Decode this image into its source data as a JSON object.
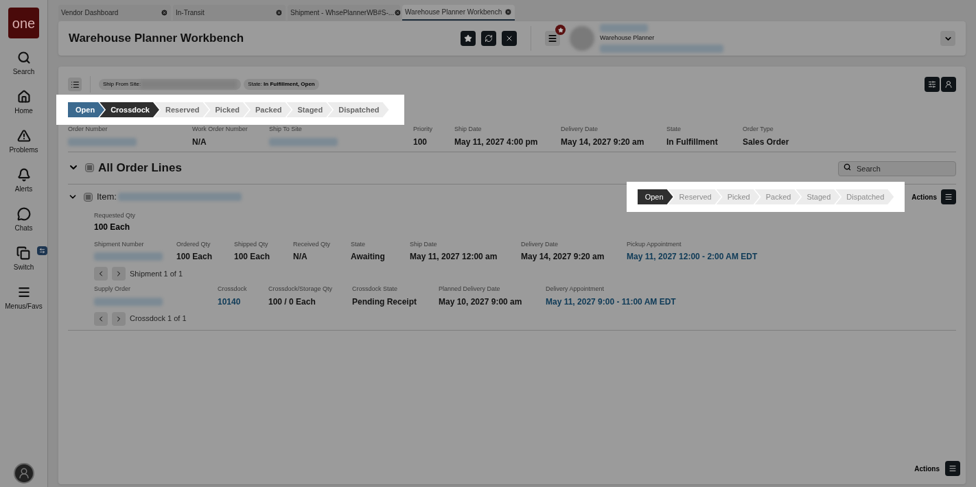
{
  "sidebar": {
    "logo": "one",
    "items": [
      {
        "label": "Search"
      },
      {
        "label": "Home"
      },
      {
        "label": "Problems"
      },
      {
        "label": "Alerts"
      },
      {
        "label": "Chats"
      },
      {
        "label": "Switch"
      },
      {
        "label": "Menus/Favs"
      }
    ]
  },
  "tabs": [
    {
      "label": "Vendor Dashboard",
      "selected": false
    },
    {
      "label": "In-Transit",
      "selected": false
    },
    {
      "label": "Shipment - WhsePlannerWB#S-...",
      "selected": false
    },
    {
      "label": "Warehouse Planner Workbench",
      "selected": true
    }
  ],
  "header": {
    "title": "Warehouse Planner Workbench",
    "user_role": "Warehouse Planner"
  },
  "filters": [
    {
      "label": "Ship From Site:",
      "redacted": true
    },
    {
      "label": "State:",
      "value": "In Fulfillment, Open"
    }
  ],
  "order_stages": [
    {
      "label": "Open",
      "kind": "complete"
    },
    {
      "label": "Crossdock",
      "kind": "current"
    },
    {
      "label": "Reserved",
      "kind": "pending"
    },
    {
      "label": "Picked",
      "kind": "pending"
    },
    {
      "label": "Packed",
      "kind": "pending"
    },
    {
      "label": "Staged",
      "kind": "pending"
    },
    {
      "label": "Dispatched",
      "kind": "pending"
    }
  ],
  "order_fields": [
    {
      "label": "Order Number",
      "redacted": true
    },
    {
      "label": "Work Order Number",
      "value": "N/A"
    },
    {
      "label": "Ship To Site",
      "redacted": true
    },
    {
      "label": "Priority",
      "value": "100"
    },
    {
      "label": "Ship Date",
      "value": "May 11, 2027 4:00 pm"
    },
    {
      "label": "Delivery Date",
      "value": "May 14, 2027 9:20 am"
    },
    {
      "label": "State",
      "value": "In Fulfillment"
    },
    {
      "label": "Order Type",
      "value": "Sales Order"
    }
  ],
  "order_lines": {
    "title": "All Order Lines",
    "expanded": true,
    "indeterminate": true,
    "search_placeholder": "Search"
  },
  "item": {
    "label": "Item:",
    "expanded": true,
    "indeterminate": true,
    "actions": "Actions",
    "stages": [
      {
        "label": "Open",
        "kind": "current"
      },
      {
        "label": "Reserved",
        "kind": "pending"
      },
      {
        "label": "Picked",
        "kind": "pending"
      },
      {
        "label": "Packed",
        "kind": "pending"
      },
      {
        "label": "Staged",
        "kind": "pending"
      },
      {
        "label": "Dispatched",
        "kind": "pending"
      }
    ],
    "requested": {
      "label": "Requested Qty",
      "value": "100 Each"
    },
    "shipment_fields": [
      {
        "label": "Shipment Number",
        "redacted": true
      },
      {
        "label": "Ordered Qty",
        "value": "100 Each",
        "link": false
      },
      {
        "label": "Shipped Qty",
        "value": "100 Each",
        "link": false
      },
      {
        "label": "Received Qty",
        "value": "N/A",
        "link": false
      },
      {
        "label": "State",
        "value": "Awaiting",
        "link": false
      },
      {
        "label": "Ship Date",
        "value": "May 11, 2027 12:00 am",
        "link": false
      },
      {
        "label": "Delivery Date",
        "value": "May 14, 2027 9:20 am",
        "link": false
      },
      {
        "label": "Pickup Appointment",
        "value": "May 11, 2027 12:00 - 2:00 AM EDT",
        "link": true
      }
    ],
    "shipment_pager": "Shipment 1 of 1",
    "crossdock_fields": [
      {
        "label": "Supply Order",
        "redacted": true
      },
      {
        "label": "Crossdock",
        "value": "10140",
        "link": true
      },
      {
        "label": "Crossdock/Storage Qty",
        "value": "100 / 0 Each",
        "link": false
      },
      {
        "label": "Crossdock State",
        "value": "Pending Receipt",
        "link": false
      },
      {
        "label": "Planned Delivery Date",
        "value": "May 10, 2027 9:00 am",
        "link": false
      },
      {
        "label": "Delivery Appointment",
        "value": "May 11, 2027 9:00 - 11:00 AM EDT",
        "link": true
      }
    ],
    "crossdock_pager": "Crossdock 1 of 1"
  },
  "footer_actions": "Actions"
}
